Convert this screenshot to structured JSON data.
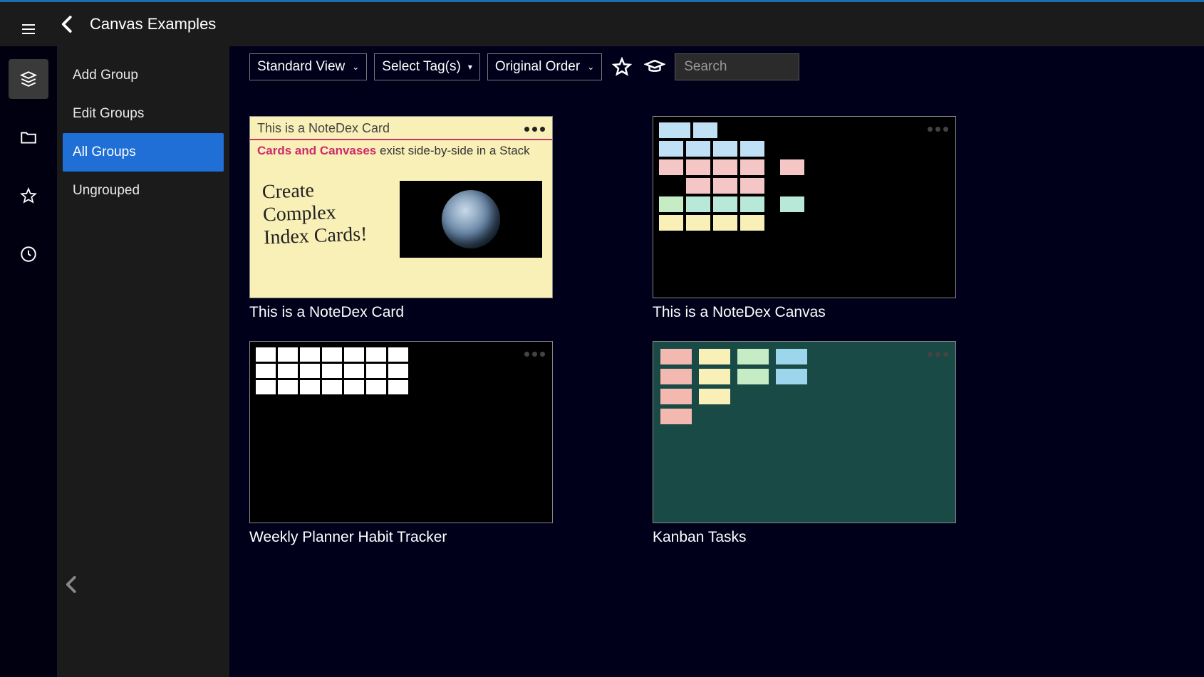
{
  "header": {
    "title": "Canvas Examples"
  },
  "rail": {
    "items": [
      {
        "name": "menu-icon"
      },
      {
        "name": "stacks-icon",
        "active": true
      },
      {
        "name": "folder-icon"
      },
      {
        "name": "star-icon"
      },
      {
        "name": "clock-icon"
      }
    ]
  },
  "sidebar": {
    "items": [
      {
        "label": "Add Group",
        "active": false
      },
      {
        "label": "Edit Groups",
        "active": false
      },
      {
        "label": "All Groups",
        "active": true
      },
      {
        "label": "Ungrouped",
        "active": false
      }
    ]
  },
  "toolbar": {
    "view_select": "Standard View",
    "tag_select": "Select Tag(s)",
    "order_select": "Original Order",
    "search_placeholder": "Search"
  },
  "cards": [
    {
      "title": "This is a NoteDex Card",
      "preview": {
        "type": "note-card",
        "heading": "This is a NoteDex Card",
        "rich_prefix": "Cards and Canvases",
        "rich_rest": " exist side-by-side in a Stack",
        "hand_line1": "Create",
        "hand_line2": "Complex",
        "hand_line3": "Index Cards!"
      }
    },
    {
      "title": "This is a NoteDex Canvas",
      "preview": {
        "type": "canvas"
      }
    },
    {
      "title": "Weekly Planner Habit Tracker",
      "preview": {
        "type": "planner"
      }
    },
    {
      "title": "Kanban Tasks",
      "preview": {
        "type": "kanban"
      }
    }
  ]
}
